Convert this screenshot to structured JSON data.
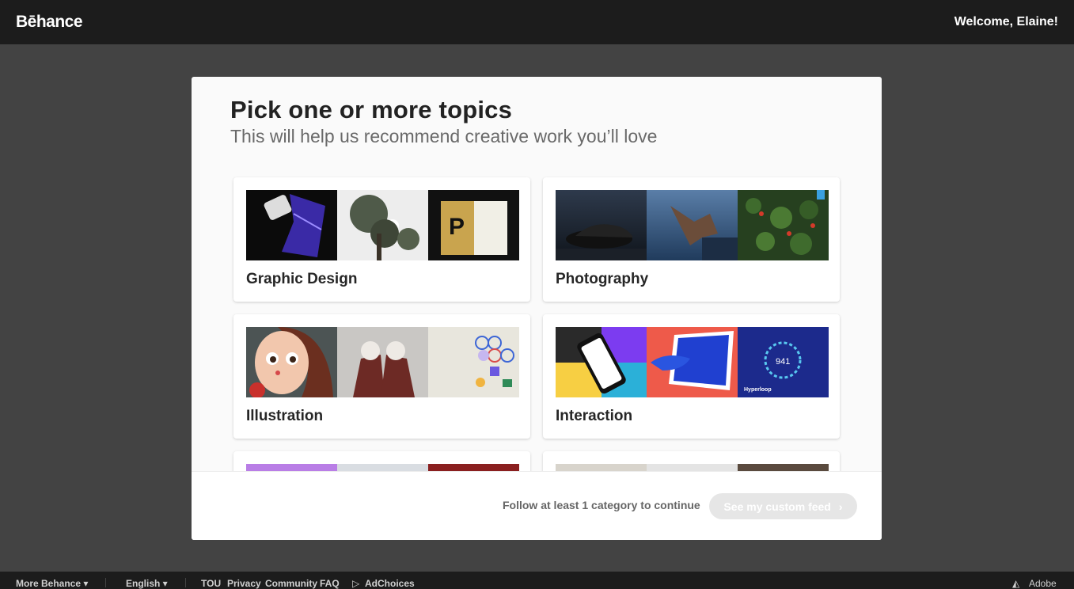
{
  "header": {
    "logo": "Bēhance",
    "welcome": "Welcome, Elaine!"
  },
  "modal": {
    "title": "Pick one or more topics",
    "subtitle": "This will help us recommend creative work you’ll love",
    "topics": [
      {
        "label": "Graphic Design"
      },
      {
        "label": "Photography"
      },
      {
        "label": "Illustration"
      },
      {
        "label": "Interaction"
      },
      {
        "label": ""
      },
      {
        "label": ""
      }
    ],
    "thumb_texts": {
      "interaction_badge": "941",
      "interaction_caption": "Hyperloop"
    },
    "footer_text": "Follow at least 1 category to continue",
    "button_label": "See my custom feed",
    "button_icon": "chevron-right-icon"
  },
  "footer": {
    "more": "More Behance ▾",
    "language": "English ▾",
    "links": [
      "TOU",
      "Privacy",
      "Community",
      "FAQ"
    ],
    "adchoices": "AdChoices",
    "brand": "Adobe"
  },
  "colors": {
    "accent_blue": "#1f3dc4",
    "button_disabled": "#e6e6e6",
    "backdrop": "#434343"
  }
}
